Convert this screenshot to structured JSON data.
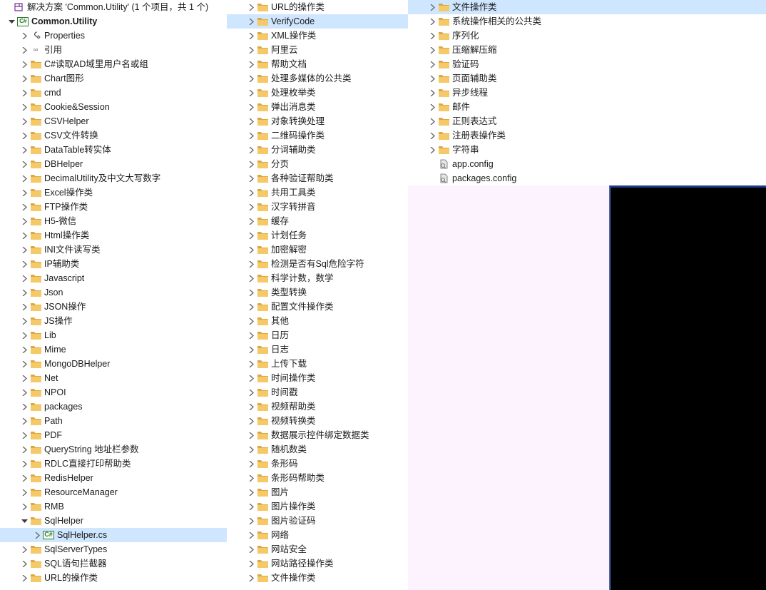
{
  "solution": {
    "label": "解决方案 'Common.Utility' (1 个项目，共 1 个)",
    "project_label": "Common.Utility"
  },
  "col1_nodes": [
    {
      "icon": "wrench",
      "label": "Properties",
      "indent": 2,
      "twisty": "closed"
    },
    {
      "icon": "refs",
      "label": "引用",
      "indent": 2,
      "twisty": "closed"
    },
    {
      "icon": "folder",
      "label": "C#读取AD域里用户名或组",
      "indent": 2,
      "twisty": "closed"
    },
    {
      "icon": "folder",
      "label": "Chart图形",
      "indent": 2,
      "twisty": "closed"
    },
    {
      "icon": "folder",
      "label": "cmd",
      "indent": 2,
      "twisty": "closed"
    },
    {
      "icon": "folder",
      "label": "Cookie&Session",
      "indent": 2,
      "twisty": "closed"
    },
    {
      "icon": "folder",
      "label": "CSVHelper",
      "indent": 2,
      "twisty": "closed"
    },
    {
      "icon": "folder",
      "label": "CSV文件转换",
      "indent": 2,
      "twisty": "closed"
    },
    {
      "icon": "folder",
      "label": "DataTable转实体",
      "indent": 2,
      "twisty": "closed"
    },
    {
      "icon": "folder",
      "label": "DBHelper",
      "indent": 2,
      "twisty": "closed"
    },
    {
      "icon": "folder",
      "label": "DecimalUtility及中文大写数字",
      "indent": 2,
      "twisty": "closed"
    },
    {
      "icon": "folder",
      "label": "Excel操作类",
      "indent": 2,
      "twisty": "closed"
    },
    {
      "icon": "folder",
      "label": "FTP操作类",
      "indent": 2,
      "twisty": "closed"
    },
    {
      "icon": "folder",
      "label": "H5-微信",
      "indent": 2,
      "twisty": "closed"
    },
    {
      "icon": "folder",
      "label": "Html操作类",
      "indent": 2,
      "twisty": "closed"
    },
    {
      "icon": "folder",
      "label": "INI文件读写类",
      "indent": 2,
      "twisty": "closed"
    },
    {
      "icon": "folder",
      "label": "IP辅助类",
      "indent": 2,
      "twisty": "closed"
    },
    {
      "icon": "folder",
      "label": "Javascript",
      "indent": 2,
      "twisty": "closed"
    },
    {
      "icon": "folder",
      "label": "Json",
      "indent": 2,
      "twisty": "closed"
    },
    {
      "icon": "folder",
      "label": "JSON操作",
      "indent": 2,
      "twisty": "closed"
    },
    {
      "icon": "folder",
      "label": "JS操作",
      "indent": 2,
      "twisty": "closed"
    },
    {
      "icon": "folder",
      "label": "Lib",
      "indent": 2,
      "twisty": "closed"
    },
    {
      "icon": "folder",
      "label": "Mime",
      "indent": 2,
      "twisty": "closed"
    },
    {
      "icon": "folder",
      "label": "MongoDBHelper",
      "indent": 2,
      "twisty": "closed"
    },
    {
      "icon": "folder",
      "label": "Net",
      "indent": 2,
      "twisty": "closed"
    },
    {
      "icon": "folder",
      "label": "NPOI",
      "indent": 2,
      "twisty": "closed"
    },
    {
      "icon": "folder",
      "label": "packages",
      "indent": 2,
      "twisty": "closed"
    },
    {
      "icon": "folder",
      "label": "Path",
      "indent": 2,
      "twisty": "closed"
    },
    {
      "icon": "folder",
      "label": "PDF",
      "indent": 2,
      "twisty": "closed"
    },
    {
      "icon": "folder",
      "label": "QueryString 地址栏参数",
      "indent": 2,
      "twisty": "closed"
    },
    {
      "icon": "folder",
      "label": "RDLC直接打印帮助类",
      "indent": 2,
      "twisty": "closed"
    },
    {
      "icon": "folder",
      "label": "RedisHelper",
      "indent": 2,
      "twisty": "closed"
    },
    {
      "icon": "folder",
      "label": "ResourceManager",
      "indent": 2,
      "twisty": "closed"
    },
    {
      "icon": "folder",
      "label": "RMB",
      "indent": 2,
      "twisty": "closed"
    },
    {
      "icon": "folder",
      "label": "SqlHelper",
      "indent": 2,
      "twisty": "open"
    },
    {
      "icon": "cs",
      "label": "SqlHelper.cs",
      "indent": 3,
      "twisty": "closed",
      "selected": true
    },
    {
      "icon": "folder",
      "label": "SqlServerTypes",
      "indent": 2,
      "twisty": "closed"
    },
    {
      "icon": "folder",
      "label": "SQL语句拦截器",
      "indent": 2,
      "twisty": "closed"
    },
    {
      "icon": "folder",
      "label": "URL的操作类",
      "indent": 2,
      "twisty": "closed"
    }
  ],
  "col2_nodes": [
    {
      "icon": "folder",
      "label": "URL的操作类",
      "indent": 2,
      "twisty": "closed"
    },
    {
      "icon": "folder",
      "label": "VerifyCode",
      "indent": 2,
      "twisty": "closed",
      "selected": true
    },
    {
      "icon": "folder",
      "label": "XML操作类",
      "indent": 2,
      "twisty": "closed"
    },
    {
      "icon": "folder",
      "label": "阿里云",
      "indent": 2,
      "twisty": "closed"
    },
    {
      "icon": "folder",
      "label": "帮助文档",
      "indent": 2,
      "twisty": "closed"
    },
    {
      "icon": "folder",
      "label": "处理多媒体的公共类",
      "indent": 2,
      "twisty": "closed"
    },
    {
      "icon": "folder",
      "label": "处理枚举类",
      "indent": 2,
      "twisty": "closed"
    },
    {
      "icon": "folder",
      "label": "弹出消息类",
      "indent": 2,
      "twisty": "closed"
    },
    {
      "icon": "folder",
      "label": "对象转换处理",
      "indent": 2,
      "twisty": "closed"
    },
    {
      "icon": "folder",
      "label": "二维码操作类",
      "indent": 2,
      "twisty": "closed"
    },
    {
      "icon": "folder",
      "label": "分词辅助类",
      "indent": 2,
      "twisty": "closed"
    },
    {
      "icon": "folder",
      "label": "分页",
      "indent": 2,
      "twisty": "closed"
    },
    {
      "icon": "folder",
      "label": "各种验证帮助类",
      "indent": 2,
      "twisty": "closed"
    },
    {
      "icon": "folder",
      "label": "共用工具类",
      "indent": 2,
      "twisty": "closed"
    },
    {
      "icon": "folder",
      "label": "汉字转拼音",
      "indent": 2,
      "twisty": "closed"
    },
    {
      "icon": "folder",
      "label": "缓存",
      "indent": 2,
      "twisty": "closed"
    },
    {
      "icon": "folder",
      "label": "计划任务",
      "indent": 2,
      "twisty": "closed"
    },
    {
      "icon": "folder",
      "label": "加密解密",
      "indent": 2,
      "twisty": "closed"
    },
    {
      "icon": "folder",
      "label": "检测是否有Sql危险字符",
      "indent": 2,
      "twisty": "closed"
    },
    {
      "icon": "folder",
      "label": "科学计数，数学",
      "indent": 2,
      "twisty": "closed"
    },
    {
      "icon": "folder",
      "label": "类型转换",
      "indent": 2,
      "twisty": "closed"
    },
    {
      "icon": "folder",
      "label": "配置文件操作类",
      "indent": 2,
      "twisty": "closed"
    },
    {
      "icon": "folder",
      "label": "其他",
      "indent": 2,
      "twisty": "closed"
    },
    {
      "icon": "folder",
      "label": "日历",
      "indent": 2,
      "twisty": "closed"
    },
    {
      "icon": "folder",
      "label": "日志",
      "indent": 2,
      "twisty": "closed"
    },
    {
      "icon": "folder",
      "label": "上传下载",
      "indent": 2,
      "twisty": "closed"
    },
    {
      "icon": "folder",
      "label": "时间操作类",
      "indent": 2,
      "twisty": "closed"
    },
    {
      "icon": "folder",
      "label": "时间戳",
      "indent": 2,
      "twisty": "closed"
    },
    {
      "icon": "folder",
      "label": "视频帮助类",
      "indent": 2,
      "twisty": "closed"
    },
    {
      "icon": "folder",
      "label": "视频转换类",
      "indent": 2,
      "twisty": "closed"
    },
    {
      "icon": "folder",
      "label": "数据展示控件绑定数据类",
      "indent": 2,
      "twisty": "closed"
    },
    {
      "icon": "folder",
      "label": "随机数类",
      "indent": 2,
      "twisty": "closed"
    },
    {
      "icon": "folder",
      "label": "条形码",
      "indent": 2,
      "twisty": "closed"
    },
    {
      "icon": "folder",
      "label": "条形码帮助类",
      "indent": 2,
      "twisty": "closed"
    },
    {
      "icon": "folder",
      "label": "图片",
      "indent": 2,
      "twisty": "closed"
    },
    {
      "icon": "folder",
      "label": "图片操作类",
      "indent": 2,
      "twisty": "closed"
    },
    {
      "icon": "folder",
      "label": "图片验证码",
      "indent": 2,
      "twisty": "closed"
    },
    {
      "icon": "folder",
      "label": "网络",
      "indent": 2,
      "twisty": "closed"
    },
    {
      "icon": "folder",
      "label": "网站安全",
      "indent": 2,
      "twisty": "closed"
    },
    {
      "icon": "folder",
      "label": "网站路径操作类",
      "indent": 2,
      "twisty": "closed"
    },
    {
      "icon": "folder",
      "label": "文件操作类",
      "indent": 2,
      "twisty": "closed"
    }
  ],
  "col3_nodes": [
    {
      "icon": "folder",
      "label": "文件操作类",
      "indent": 2,
      "twisty": "closed",
      "selected": true
    },
    {
      "icon": "folder",
      "label": "系统操作相关的公共类",
      "indent": 2,
      "twisty": "closed"
    },
    {
      "icon": "folder",
      "label": "序列化",
      "indent": 2,
      "twisty": "closed"
    },
    {
      "icon": "folder",
      "label": "压缩解压缩",
      "indent": 2,
      "twisty": "closed"
    },
    {
      "icon": "folder",
      "label": "验证码",
      "indent": 2,
      "twisty": "closed"
    },
    {
      "icon": "folder",
      "label": "页面辅助类",
      "indent": 2,
      "twisty": "closed"
    },
    {
      "icon": "folder",
      "label": "异步线程",
      "indent": 2,
      "twisty": "closed"
    },
    {
      "icon": "folder",
      "label": "邮件",
      "indent": 2,
      "twisty": "closed"
    },
    {
      "icon": "folder",
      "label": "正则表达式",
      "indent": 2,
      "twisty": "closed"
    },
    {
      "icon": "folder",
      "label": "注册表操作类",
      "indent": 2,
      "twisty": "closed"
    },
    {
      "icon": "folder",
      "label": "字符串",
      "indent": 2,
      "twisty": "closed"
    },
    {
      "icon": "config",
      "label": "app.config",
      "indent": 2,
      "twisty": "none"
    },
    {
      "icon": "config",
      "label": "packages.config",
      "indent": 2,
      "twisty": "none"
    }
  ]
}
